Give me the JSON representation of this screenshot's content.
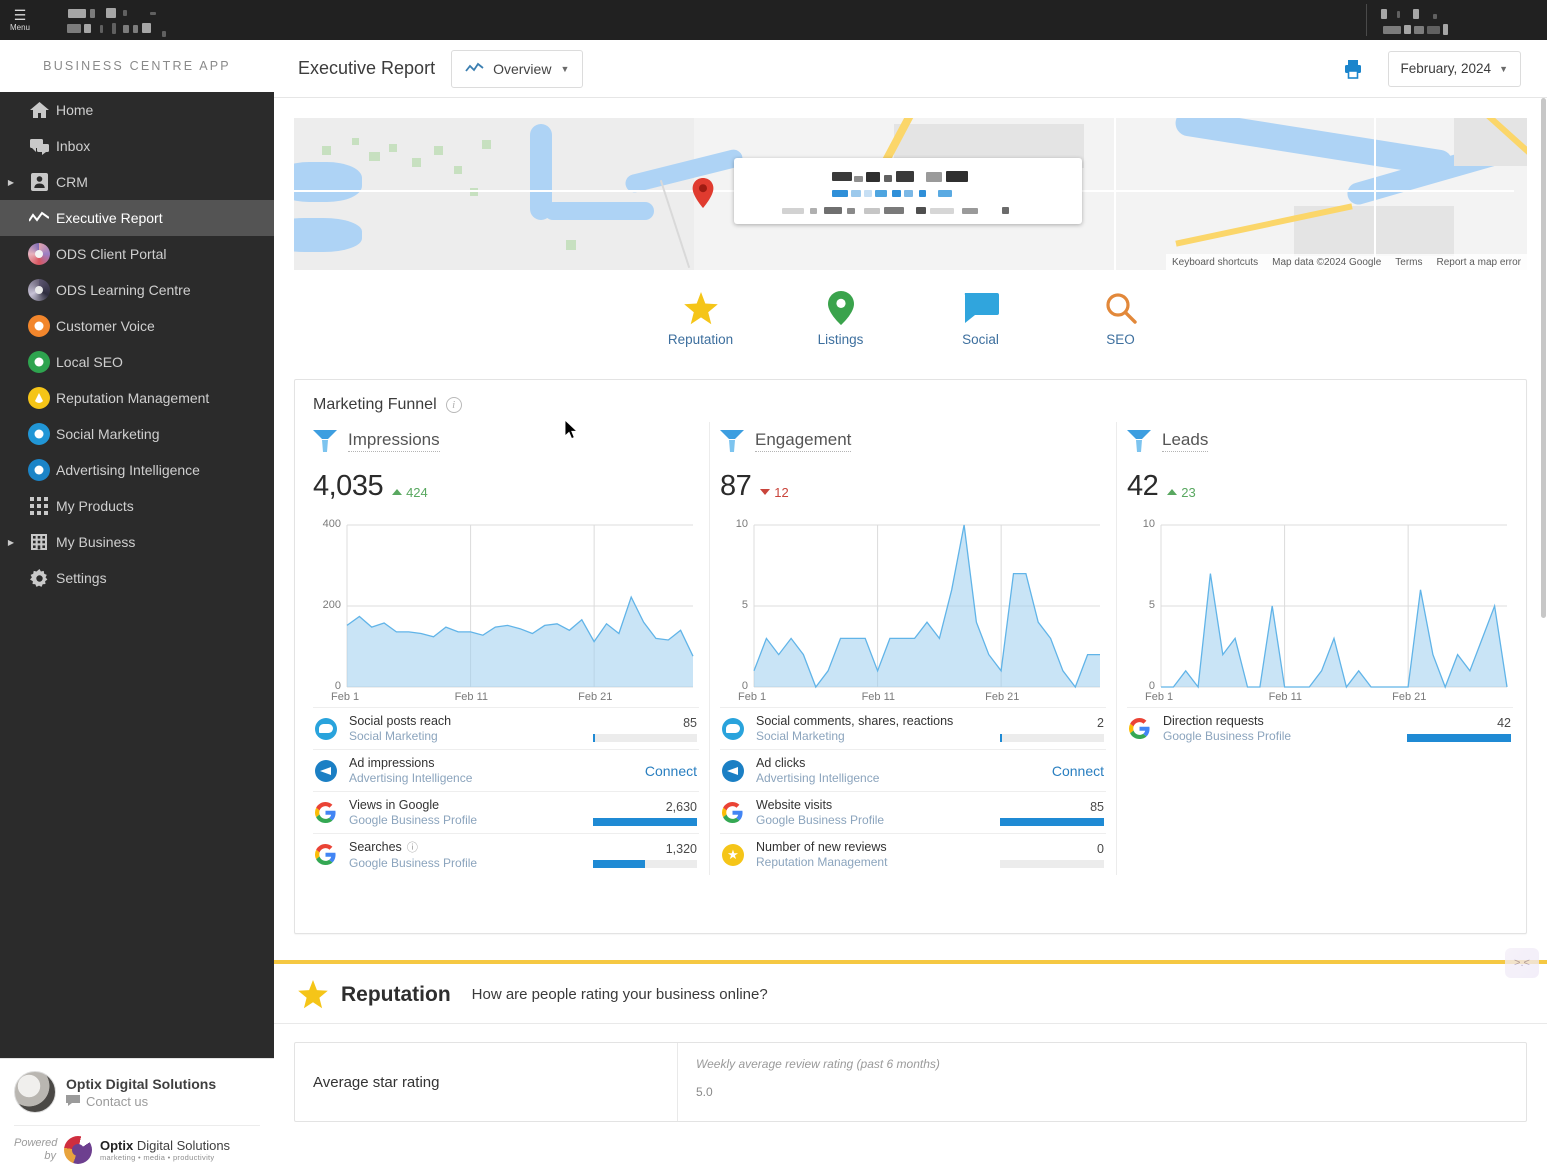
{
  "window": {
    "menu_label": "Menu"
  },
  "sidebar": {
    "brand": "BUSINESS CENTRE APP",
    "items": [
      {
        "label": "Home",
        "icon": "home-icon",
        "expandable": false,
        "active": false
      },
      {
        "label": "Inbox",
        "icon": "inbox-icon",
        "expandable": false,
        "active": false
      },
      {
        "label": "CRM",
        "icon": "contact-card-icon",
        "expandable": true,
        "active": false
      },
      {
        "label": "Executive Report",
        "icon": "trendline-icon",
        "expandable": false,
        "active": true
      },
      {
        "label": "ODS Client Portal",
        "icon": "ods-portal-icon",
        "expandable": false,
        "active": false
      },
      {
        "label": "ODS Learning Centre",
        "icon": "ods-learning-icon",
        "expandable": false,
        "active": false
      },
      {
        "label": "Customer Voice",
        "icon": "heart-badge-icon",
        "expandable": false,
        "active": false
      },
      {
        "label": "Local SEO",
        "icon": "map-pin-icon",
        "expandable": false,
        "active": false
      },
      {
        "label": "Reputation Management",
        "icon": "star-badge-icon",
        "expandable": false,
        "active": false
      },
      {
        "label": "Social Marketing",
        "icon": "chat-badge-icon",
        "expandable": false,
        "active": false
      },
      {
        "label": "Advertising Intelligence",
        "icon": "megaphone-icon",
        "expandable": false,
        "active": false
      },
      {
        "label": "My Products",
        "icon": "grid-icon",
        "expandable": false,
        "active": false
      },
      {
        "label": "My Business",
        "icon": "building-icon",
        "expandable": true,
        "active": false
      },
      {
        "label": "Settings",
        "icon": "gear-icon",
        "expandable": false,
        "active": false
      }
    ],
    "account": {
      "name": "Optix Digital Solutions",
      "contact": "Contact us"
    },
    "powered": {
      "prefix_line1": "Powered",
      "prefix_line2": "by",
      "brand_bold": "Optix",
      "brand_rest": " Digital Solutions",
      "tagline": "marketing • media • productivity"
    }
  },
  "header": {
    "title": "Executive Report",
    "overview_label": "Overview",
    "print_icon": "printer-icon",
    "date_label": "February, 2024"
  },
  "map": {
    "attribution": [
      "Keyboard shortcuts",
      "Map data ©2024 Google",
      "Terms",
      "Report a map error"
    ]
  },
  "icon_nav": [
    {
      "label": "Reputation",
      "icon": "star-icon",
      "color": "#f5c518"
    },
    {
      "label": "Listings",
      "icon": "map-pin-icon",
      "color": "#3aa34c"
    },
    {
      "label": "Social",
      "icon": "speech-bubble-icon",
      "color": "#30a5dd"
    },
    {
      "label": "SEO",
      "icon": "magnifier-icon",
      "color": "#e2883a"
    }
  ],
  "funnel": {
    "title": "Marketing Funnel",
    "info_icon": "info-icon",
    "connect_label": "Connect",
    "columns": [
      {
        "name": "Impressions",
        "value": "4,035",
        "delta": "424",
        "delta_dir": "up",
        "rows": [
          {
            "title": "Social posts reach",
            "source": "Social Marketing",
            "icon": "social-marketing-icon",
            "value": "85",
            "bar_pct": 2,
            "has_bar": true,
            "has_info": false
          },
          {
            "title": "Ad impressions",
            "source": "Advertising Intelligence",
            "icon": "advertising-intelligence-icon",
            "value": "",
            "bar_pct": 0,
            "has_bar": false,
            "has_info": false
          },
          {
            "title": "Views in Google",
            "source": "Google Business Profile",
            "icon": "google-icon",
            "value": "2,630",
            "bar_pct": 100,
            "has_bar": true,
            "has_info": false
          },
          {
            "title": "Searches",
            "source": "Google Business Profile",
            "icon": "google-icon",
            "value": "1,320",
            "bar_pct": 50,
            "has_bar": true,
            "has_info": true
          }
        ]
      },
      {
        "name": "Engagement",
        "value": "87",
        "delta": "12",
        "delta_dir": "down",
        "rows": [
          {
            "title": "Social comments, shares, reactions",
            "source": "Social Marketing",
            "icon": "social-marketing-icon",
            "value": "2",
            "bar_pct": 2,
            "has_bar": true,
            "has_info": false
          },
          {
            "title": "Ad clicks",
            "source": "Advertising Intelligence",
            "icon": "advertising-intelligence-icon",
            "value": "",
            "bar_pct": 0,
            "has_bar": false,
            "has_info": false
          },
          {
            "title": "Website visits",
            "source": "Google Business Profile",
            "icon": "google-icon",
            "value": "85",
            "bar_pct": 100,
            "has_bar": true,
            "has_info": false
          },
          {
            "title": "Number of new reviews",
            "source": "Reputation Management",
            "icon": "reputation-icon",
            "value": "0",
            "bar_pct": 0,
            "has_bar": true,
            "has_info": false
          }
        ]
      },
      {
        "name": "Leads",
        "value": "42",
        "delta": "23",
        "delta_dir": "up",
        "rows": [
          {
            "title": "Direction requests",
            "source": "Google Business Profile",
            "icon": "google-icon",
            "value": "42",
            "bar_pct": 100,
            "has_bar": true,
            "has_info": false
          }
        ]
      }
    ]
  },
  "reputation": {
    "title": "Reputation",
    "subtitle": "How are people rating your business online?",
    "icon": "star-icon",
    "avg_star_label": "Average star rating",
    "weekly_caption": "Weekly average review rating (past 6 months)",
    "weekly_ymax": "5.0"
  },
  "chart_data": [
    {
      "type": "area",
      "title": "Impressions",
      "xlabel": "",
      "ylabel": "",
      "ylim": [
        0,
        400
      ],
      "yticks": [
        0,
        200,
        400
      ],
      "xtick_labels": [
        "Feb 1",
        "Feb 11",
        "Feb 21"
      ],
      "x": [
        "Feb 1",
        "Feb 2",
        "Feb 3",
        "Feb 4",
        "Feb 5",
        "Feb 6",
        "Feb 7",
        "Feb 8",
        "Feb 9",
        "Feb 10",
        "Feb 11",
        "Feb 12",
        "Feb 13",
        "Feb 14",
        "Feb 15",
        "Feb 16",
        "Feb 17",
        "Feb 18",
        "Feb 19",
        "Feb 20",
        "Feb 21",
        "Feb 22",
        "Feb 23",
        "Feb 24",
        "Feb 25",
        "Feb 26",
        "Feb 27",
        "Feb 28",
        "Feb 29"
      ],
      "values": [
        152,
        174,
        148,
        158,
        136,
        136,
        132,
        124,
        148,
        136,
        136,
        128,
        148,
        152,
        144,
        132,
        152,
        156,
        140,
        166,
        112,
        156,
        132,
        222,
        160,
        120,
        116,
        140,
        76
      ],
      "grid": true,
      "legend": "none",
      "accent": "#9ccdee"
    },
    {
      "type": "area",
      "title": "Engagement",
      "xlabel": "",
      "ylabel": "",
      "ylim": [
        0,
        10
      ],
      "yticks": [
        0,
        5,
        10
      ],
      "xtick_labels": [
        "Feb 1",
        "Feb 11",
        "Feb 21"
      ],
      "x": [
        "Feb 1",
        "Feb 2",
        "Feb 3",
        "Feb 4",
        "Feb 5",
        "Feb 6",
        "Feb 7",
        "Feb 8",
        "Feb 9",
        "Feb 10",
        "Feb 11",
        "Feb 12",
        "Feb 13",
        "Feb 14",
        "Feb 15",
        "Feb 16",
        "Feb 17",
        "Feb 18",
        "Feb 19",
        "Feb 20",
        "Feb 21",
        "Feb 22",
        "Feb 23",
        "Feb 24",
        "Feb 25",
        "Feb 26",
        "Feb 27",
        "Feb 28",
        "Feb 29"
      ],
      "values": [
        1,
        3,
        2,
        3,
        2,
        0,
        1,
        3,
        3,
        3,
        1,
        3,
        3,
        3,
        4,
        3,
        6,
        10,
        4,
        2,
        1,
        7,
        7,
        4,
        3,
        1,
        0,
        2,
        2
      ],
      "grid": true,
      "legend": "none",
      "accent": "#9ccdee"
    },
    {
      "type": "area",
      "title": "Leads",
      "xlabel": "",
      "ylabel": "",
      "ylim": [
        0,
        10
      ],
      "yticks": [
        0,
        5,
        10
      ],
      "xtick_labels": [
        "Feb 1",
        "Feb 11",
        "Feb 21"
      ],
      "x": [
        "Feb 1",
        "Feb 2",
        "Feb 3",
        "Feb 4",
        "Feb 5",
        "Feb 6",
        "Feb 7",
        "Feb 8",
        "Feb 9",
        "Feb 10",
        "Feb 11",
        "Feb 12",
        "Feb 13",
        "Feb 14",
        "Feb 15",
        "Feb 16",
        "Feb 17",
        "Feb 18",
        "Feb 19",
        "Feb 20",
        "Feb 21",
        "Feb 22",
        "Feb 23",
        "Feb 24",
        "Feb 25",
        "Feb 26",
        "Feb 27",
        "Feb 28",
        "Feb 29"
      ],
      "values": [
        0,
        0,
        1,
        0,
        7,
        2,
        3,
        0,
        0,
        5,
        0,
        0,
        0,
        1,
        3,
        0,
        1,
        0,
        0,
        0,
        0,
        6,
        2,
        0,
        2,
        1,
        3,
        5,
        0
      ],
      "grid": true,
      "legend": "none",
      "accent": "#9ccdee"
    }
  ]
}
